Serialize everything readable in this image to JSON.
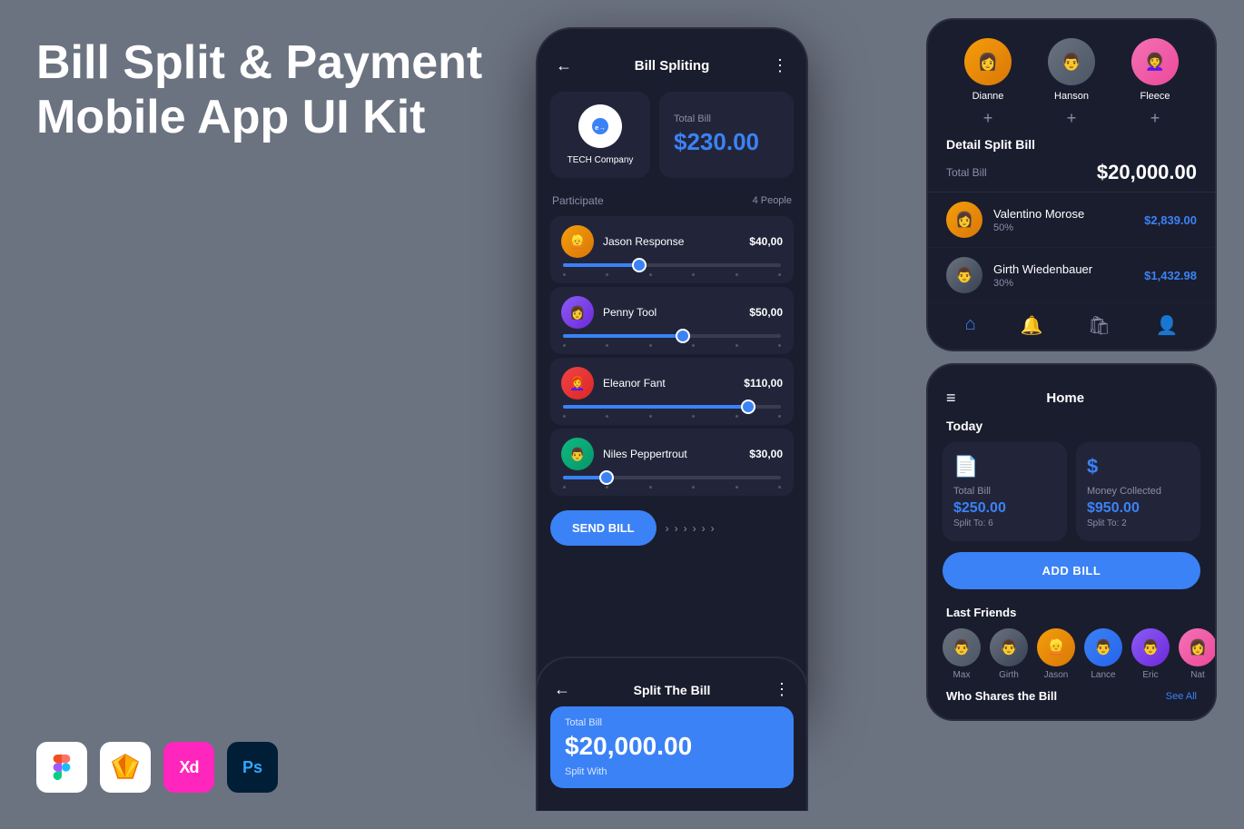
{
  "hero": {
    "title": "Bill Split & Payment Mobile App UI Kit"
  },
  "tools": [
    {
      "name": "Figma",
      "label": "F"
    },
    {
      "name": "Sketch",
      "label": "S"
    },
    {
      "name": "XD",
      "label": "Xd"
    },
    {
      "name": "Photoshop",
      "label": "Ps"
    }
  ],
  "phone_center": {
    "header_title": "Bill Spliting",
    "company_name": "TECH Company",
    "total_bill_label": "Total Bill",
    "total_bill_amount": "$230.00",
    "participate_label": "Participate",
    "participate_count": "4 People",
    "persons": [
      {
        "name": "Jason Response",
        "amount": "$40,00",
        "slider_pct": 35,
        "avatar_class": "av-jason"
      },
      {
        "name": "Penny Tool",
        "amount": "$50,00",
        "slider_pct": 55,
        "avatar_class": "av-penny"
      },
      {
        "name": "Eleanor Fant",
        "amount": "$110,00",
        "slider_pct": 85,
        "avatar_class": "av-eleanor"
      },
      {
        "name": "Niles Peppertrout",
        "amount": "$30,00",
        "slider_pct": 20,
        "avatar_class": "av-niles"
      }
    ],
    "send_btn": "SEND BILL"
  },
  "right_top": {
    "avatars": [
      {
        "name": "Dianne",
        "class": "av-dianne"
      },
      {
        "name": "Hanson",
        "class": "av-hanson"
      },
      {
        "name": "Fleece",
        "class": "av-fleece"
      }
    ],
    "detail_split_label": "Detail Split Bill",
    "total_bill_label": "Total Bill",
    "total_bill_amount": "$20,000.00",
    "persons": [
      {
        "name": "Valentino Morose",
        "pct": "50%",
        "amount": "$2,839.00",
        "class": "av-valentino"
      },
      {
        "name": "Girth Wiedenbauer",
        "pct": "30%",
        "amount": "$1,432.98",
        "class": "av-girth"
      }
    ]
  },
  "right_bottom": {
    "title": "Home",
    "today_label": "Today",
    "cards": [
      {
        "icon": "📄",
        "title": "Total Bill",
        "amount": "$250.00",
        "sub": "Split To: 6"
      },
      {
        "icon": "$",
        "title": "Money Collected",
        "amount": "$950.00",
        "sub": "Split To: 2"
      }
    ],
    "add_bill_btn": "ADD BILL",
    "last_friends_label": "Last Friends",
    "see_all": "See All",
    "friends": [
      {
        "name": "Max",
        "class": "av-max"
      },
      {
        "name": "Girth",
        "class": "av-girth"
      },
      {
        "name": "Jason",
        "class": "av-jason"
      },
      {
        "name": "Lance",
        "class": "av-lance"
      },
      {
        "name": "Eric",
        "class": "av-eric"
      },
      {
        "name": "Nat",
        "class": "av-fleece"
      }
    ],
    "who_shares_label": "Who Shares the Bill",
    "who_shares_see_all": "See All"
  },
  "phone_bottom": {
    "title": "Split The Bill",
    "total_bill_label": "Total Bill",
    "total_amount": "$20,000.00",
    "split_with_label": "Split With"
  }
}
